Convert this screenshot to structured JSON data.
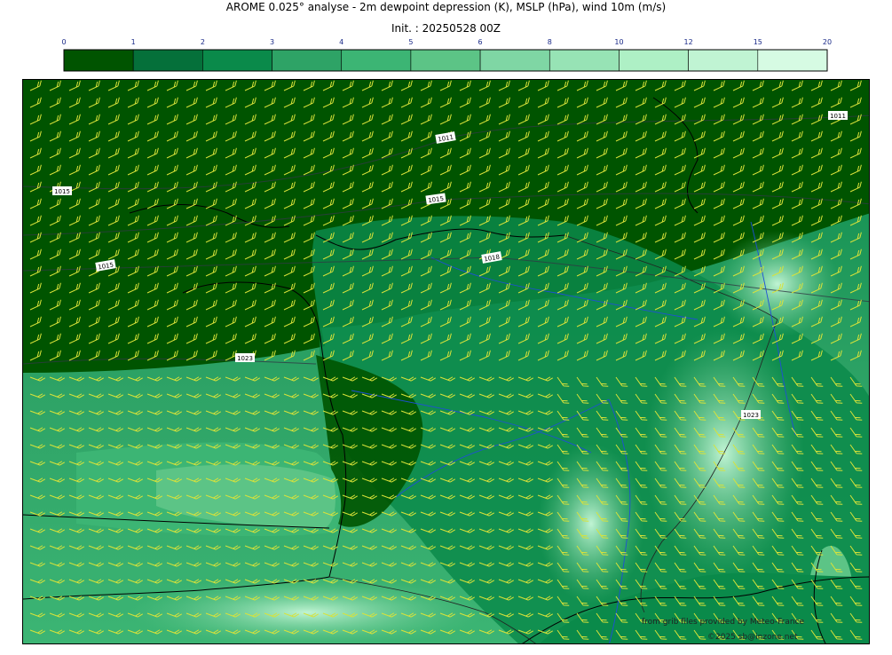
{
  "header": {
    "title": "AROME 0.025° analyse - 2m dewpoint depression (K), MSLP (hPa), wind 10m (m/s)",
    "init": "Init. : 20250528 00Z"
  },
  "colorbar": {
    "ticks": [
      "0",
      "1",
      "2",
      "3",
      "4",
      "5",
      "6",
      "8",
      "10",
      "12",
      "15",
      "20"
    ],
    "colors": [
      "#005400",
      "#05703a",
      "#0a8a4a",
      "#2ea366",
      "#3cb574",
      "#5cc486",
      "#7fd6a4",
      "#97e3b5",
      "#aef0c5",
      "#c0f4d3",
      "#d6fbe3"
    ],
    "tick_color": "#1a2a88"
  },
  "map": {
    "isobars": [
      "1011",
      "1011",
      "1015",
      "1015",
      "1015",
      "1018",
      "1023",
      "1023"
    ],
    "land_colors": {
      "dark": "#005400",
      "mid": "#0a8a4a",
      "light": "#5cc486",
      "pale": "#b5f0c8"
    },
    "barb_color": "#d8e23a",
    "river_color": "#1f4fd6"
  },
  "credits": {
    "line1": "from grib files provided by Meteo-France",
    "line2": "©2025 sb@inzone.net"
  }
}
